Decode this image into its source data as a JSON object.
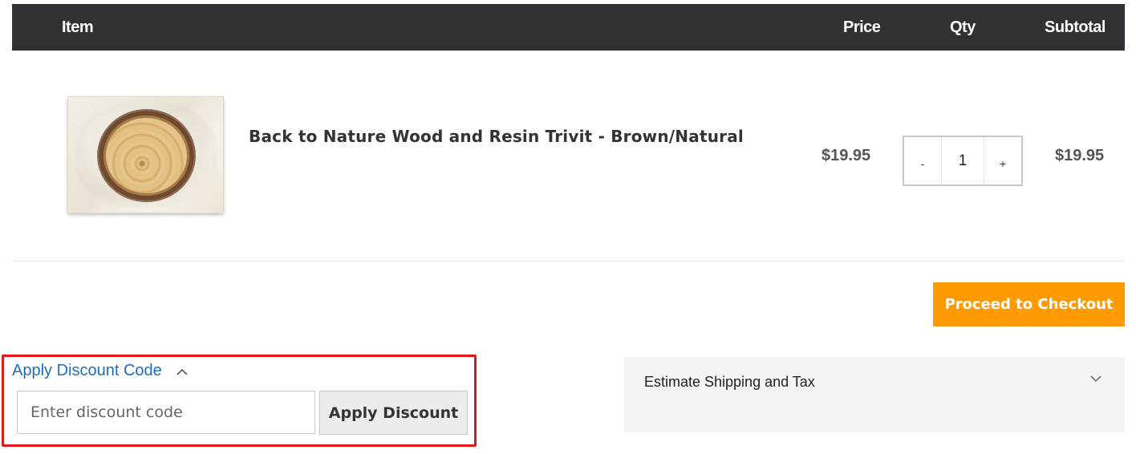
{
  "table_header": {
    "item": "Item",
    "price": "Price",
    "qty": "Qty",
    "subtotal": "Subtotal"
  },
  "cart_item": {
    "name": "Back to Nature Wood and Resin Trivit - Brown/Natural",
    "price": "$19.95",
    "qty": "1",
    "qty_minus": "-",
    "qty_plus": "+",
    "subtotal": "$19.95",
    "image_icon": "product-thumbnail"
  },
  "checkout": {
    "label": "Proceed to Checkout",
    "color": "#ff9a00"
  },
  "discount": {
    "toggle_label": "Apply Discount Code",
    "toggle_icon": "chevron-up-icon",
    "placeholder": "Enter discount code",
    "button_label": "Apply Discount",
    "highlight_color": "#e8141d",
    "link_color": "#1d6fbd"
  },
  "shipping": {
    "title": "Estimate Shipping and Tax",
    "icon": "chevron-down-icon"
  },
  "colors": {
    "header_bg": "#313035"
  }
}
